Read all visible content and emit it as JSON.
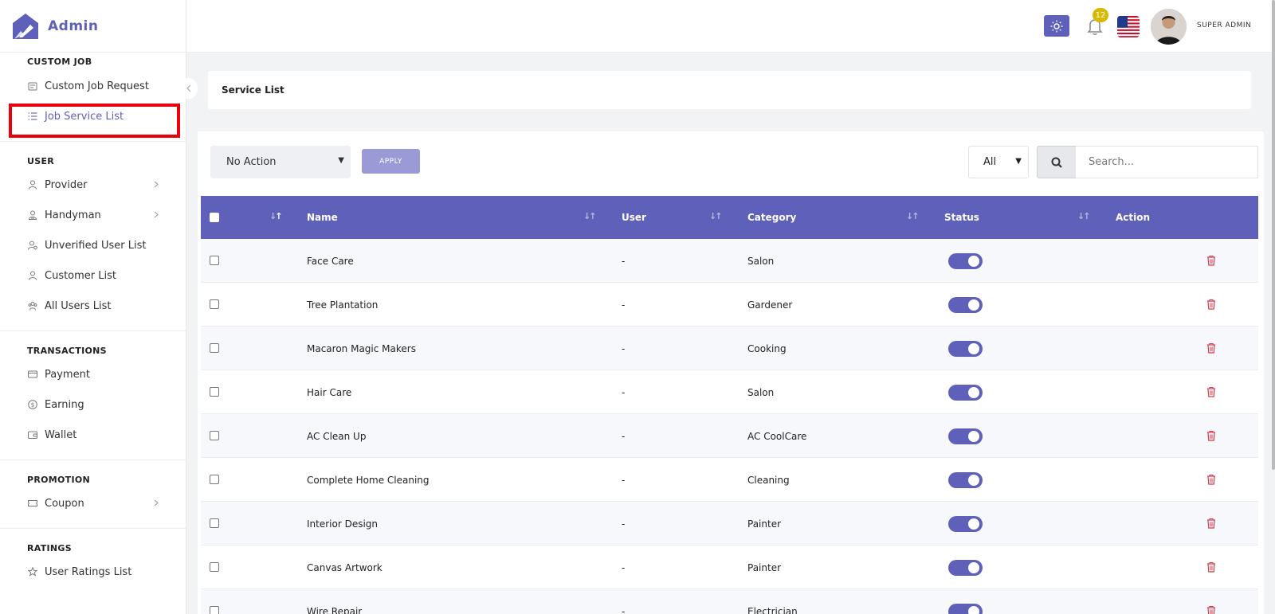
{
  "brand": {
    "name": "Admin"
  },
  "sidebar": {
    "sections": [
      {
        "title": "CUSTOM JOB",
        "items": [
          {
            "label": "Custom Job Request",
            "icon": "clipboard-icon",
            "chevron": false
          },
          {
            "label": "Job Service List",
            "icon": "list-icon",
            "chevron": false,
            "active": true
          }
        ]
      },
      {
        "title": "USER",
        "items": [
          {
            "label": "Provider",
            "icon": "user-icon",
            "chevron": true
          },
          {
            "label": "Handyman",
            "icon": "user-tool-icon",
            "chevron": true
          },
          {
            "label": "Unverified User List",
            "icon": "user-x-icon",
            "chevron": false
          },
          {
            "label": "Customer List",
            "icon": "user-icon",
            "chevron": false
          },
          {
            "label": "All Users List",
            "icon": "users-icon",
            "chevron": false
          }
        ]
      },
      {
        "title": "TRANSACTIONS",
        "items": [
          {
            "label": "Payment",
            "icon": "credit-card-icon",
            "chevron": false
          },
          {
            "label": "Earning",
            "icon": "dollar-circle-icon",
            "chevron": false
          },
          {
            "label": "Wallet",
            "icon": "wallet-icon",
            "chevron": false
          }
        ]
      },
      {
        "title": "PROMOTION",
        "items": [
          {
            "label": "Coupon",
            "icon": "ticket-icon",
            "chevron": true
          }
        ]
      },
      {
        "title": "RATINGS",
        "items": [
          {
            "label": "User Ratings List",
            "icon": "star-icon",
            "chevron": false
          }
        ]
      }
    ]
  },
  "header": {
    "notifications_count": "12",
    "admin_name": "SUPER ADMIN"
  },
  "page": {
    "title": "Service List"
  },
  "toolbar": {
    "bulk_action": "No Action",
    "apply_label": "APPLY",
    "filter_value": "All",
    "search_placeholder": "Search..."
  },
  "table": {
    "columns": [
      "Name",
      "User",
      "Category",
      "Status",
      "Action"
    ],
    "rows": [
      {
        "name": "Face Care",
        "user": "-",
        "category": "Salon",
        "status_on": true
      },
      {
        "name": "Tree Plantation",
        "user": "-",
        "category": "Gardener",
        "status_on": true
      },
      {
        "name": "Macaron Magic Makers",
        "user": "-",
        "category": "Cooking",
        "status_on": true
      },
      {
        "name": "Hair Care",
        "user": "-",
        "category": "Salon",
        "status_on": true
      },
      {
        "name": "AC Clean Up",
        "user": "-",
        "category": "AC CoolCare",
        "status_on": true
      },
      {
        "name": "Complete Home Cleaning",
        "user": "-",
        "category": "Cleaning",
        "status_on": true
      },
      {
        "name": "Interior Design",
        "user": "-",
        "category": "Painter",
        "status_on": true
      },
      {
        "name": "Canvas Artwork",
        "user": "-",
        "category": "Painter",
        "status_on": true
      },
      {
        "name": "Wire Repair",
        "user": "-",
        "category": "Electrician",
        "status_on": true
      }
    ]
  },
  "colors": {
    "accent": "#5f60b9",
    "highlight": "#e8000b",
    "danger": "#d9394a"
  }
}
